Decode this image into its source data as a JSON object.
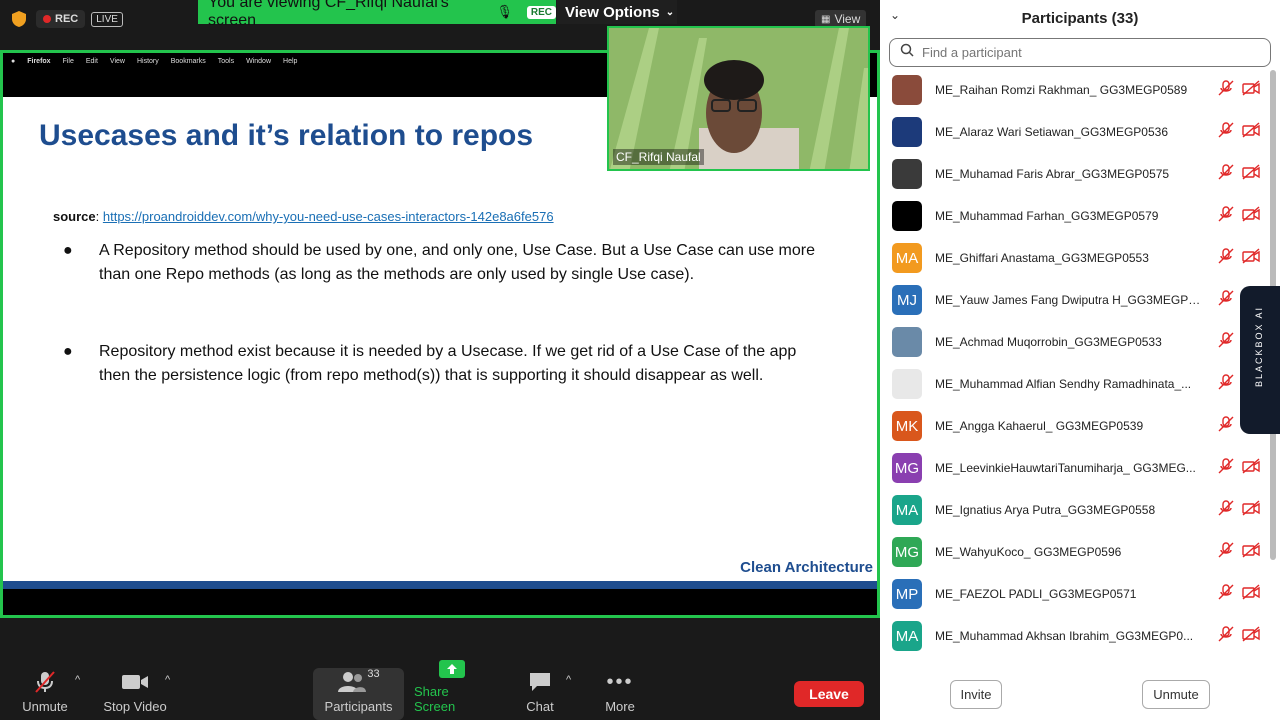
{
  "top": {
    "rec_label": "REC",
    "live_label": "LIVE",
    "share_banner": "You are viewing CF_Rifqi Naufal's screen",
    "share_rec": "REC",
    "view_options": "View Options",
    "view_label": "View"
  },
  "screen": {
    "menu": [
      "Firefox",
      "File",
      "Edit",
      "View",
      "History",
      "Bookmarks",
      "Tools",
      "Window",
      "Help"
    ],
    "slide_title": "Usecases and it’s relation to repos",
    "source_label": "source",
    "source_link": "https://proandroiddev.com/why-you-need-use-cases-interactors-142e8a6fe576",
    "bullet1": "A Repository method should be used by one, and only one, Use Case. But a Use Case can use more than one Repo methods (as long as the methods are only used by single Use case).",
    "bullet2": "Repository method exist because it is needed by a Usecase. If we get rid of a Use Case of the app then the persistence logic (from repo method(s)) that is supporting it should disappear as well.",
    "footer": "Clean Architecture"
  },
  "speaker": {
    "name": "CF_Rifqi Naufal"
  },
  "toolbar": {
    "unmute": "Unmute",
    "stop_video": "Stop Video",
    "participants": "Participants",
    "participants_count": "33",
    "share_screen": "Share Screen",
    "chat": "Chat",
    "more": "More",
    "leave": "Leave"
  },
  "panel": {
    "title": "Participants (33)",
    "search_placeholder": "Find a participant",
    "side_tab": "BLACKBOX AI",
    "invite": "Invite",
    "unmute": "Unmute",
    "participants": [
      {
        "name": "ME_Raihan Romzi Rakhman_ GG3MEGP0589",
        "initials": "",
        "color": "#8a4b3b"
      },
      {
        "name": "ME_Alaraz Wari Setiawan_GG3MEGP0536",
        "initials": "",
        "color": "#1c3a7a"
      },
      {
        "name": "ME_Muhamad Faris Abrar_GG3MEGP0575",
        "initials": "",
        "color": "#3a3a3a"
      },
      {
        "name": "ME_Muhammad Farhan_GG3MEGP0579",
        "initials": "",
        "color": "#000000"
      },
      {
        "name": "ME_Ghiffari Anastama_GG3MEGP0553",
        "initials": "MA",
        "color": "#f29a1f"
      },
      {
        "name": "ME_Yauw James Fang Dwiputra H_GG3MEGP0...",
        "initials": "MJ",
        "color": "#2a6fb8"
      },
      {
        "name": "ME_Achmad Muqorrobin_GG3MEGP0533",
        "initials": "",
        "color": "#6a8aa8"
      },
      {
        "name": "ME_Muhammad Alfian Sendhy Ramadhinata_...",
        "initials": "",
        "color": "#e8e8e8"
      },
      {
        "name": "ME_Angga Kahaerul_ GG3MEGP0539",
        "initials": "MK",
        "color": "#d9571c"
      },
      {
        "name": "ME_LeevinkieHauwtariTanumiharja_ GG3MEG...",
        "initials": "MG",
        "color": "#8a3fb0"
      },
      {
        "name": "ME_Ignatius Arya Putra_GG3MEGP0558",
        "initials": "MA",
        "color": "#1aa58a"
      },
      {
        "name": "ME_WahyuKoco_ GG3MEGP0596",
        "initials": "MG",
        "color": "#2fa856"
      },
      {
        "name": "ME_FAEZOL PADLI_GG3MEGP0571",
        "initials": "MP",
        "color": "#2a6fb8"
      },
      {
        "name": "ME_Muhammad Akhsan Ibrahim_GG3MEGP0...",
        "initials": "MA",
        "color": "#1aa58a"
      }
    ]
  },
  "colors": {
    "accent": "#23c44d",
    "leave": "#e02828",
    "slide_blue": "#1e4d8f"
  }
}
